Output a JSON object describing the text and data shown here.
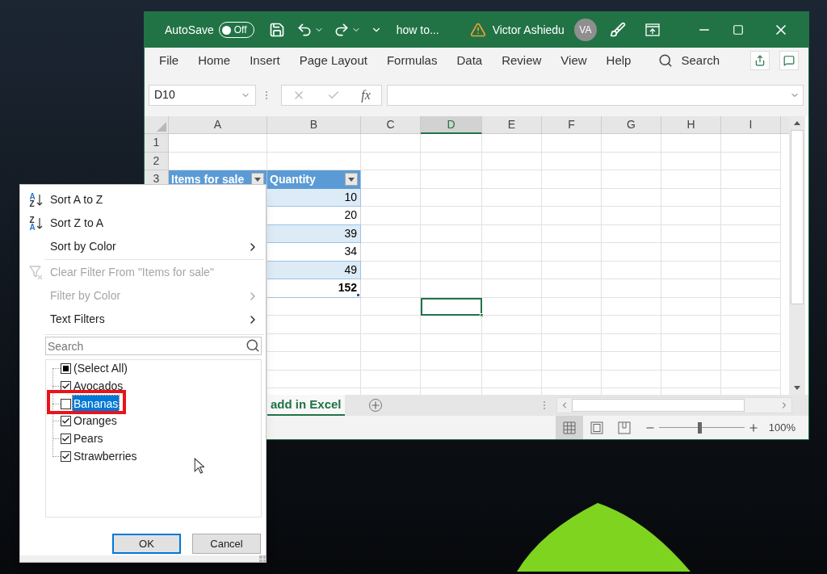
{
  "excel": {
    "title_bar": {
      "autosave_label": "AutoSave",
      "autosave_on": false,
      "autosave_state": "Off",
      "file_name": "how to...",
      "user_name": "Victor Ashiedu",
      "user_initials": "VA"
    },
    "ribbon_tabs": [
      "File",
      "Home",
      "Insert",
      "Page Layout",
      "Formulas",
      "Data",
      "Review",
      "View",
      "Help"
    ],
    "search_label": "Search",
    "name_box": "D10",
    "formula_fx": "fx",
    "columns": [
      {
        "label": "A",
        "selected": false
      },
      {
        "label": "B",
        "selected": false
      },
      {
        "label": "C",
        "selected": false
      },
      {
        "label": "D",
        "selected": true
      },
      {
        "label": "E",
        "selected": false
      },
      {
        "label": "F",
        "selected": false
      },
      {
        "label": "G",
        "selected": false
      },
      {
        "label": "H",
        "selected": false
      },
      {
        "label": "I",
        "selected": false
      }
    ],
    "row_numbers": [
      "1",
      "2",
      "3"
    ],
    "table_headers": [
      "Items for sale",
      "Quantity"
    ],
    "quantities": [
      {
        "value": "10",
        "banded": true,
        "kind": "data"
      },
      {
        "value": "20",
        "banded": false,
        "kind": "data"
      },
      {
        "value": "39",
        "banded": true,
        "kind": "data"
      },
      {
        "value": "34",
        "banded": false,
        "kind": "data"
      },
      {
        "value": "49",
        "banded": true,
        "kind": "data"
      },
      {
        "value": "152",
        "banded": false,
        "kind": "total"
      }
    ],
    "sheet_tab": "add in Excel",
    "view_buttons": [
      {
        "kind": "normal",
        "selected": true
      },
      {
        "kind": "page_layout",
        "selected": false
      },
      {
        "kind": "page_break",
        "selected": false
      }
    ],
    "zoom": {
      "level": 0.47,
      "reading": "100%"
    }
  },
  "filter_menu": {
    "items": [
      {
        "kind": "sort",
        "label": "Sort A to Z",
        "disabled": false,
        "icon_letters": [
          {
            "text": "A",
            "color": "#2b79d0"
          },
          {
            "text": "Z",
            "color": "#333333"
          }
        ]
      },
      {
        "kind": "sort",
        "label": "Sort Z to A",
        "disabled": false,
        "icon_letters": [
          {
            "text": "Z",
            "color": "#333333"
          },
          {
            "text": "A",
            "color": "#2b79d0"
          }
        ]
      },
      {
        "kind": "submenu",
        "label": "Sort by Color",
        "disabled": false
      },
      {
        "kind": "divider"
      },
      {
        "kind": "clear",
        "label": "Clear Filter From \"Items for sale\"",
        "disabled": true
      },
      {
        "kind": "submenu",
        "label": "Filter by Color",
        "disabled": true
      },
      {
        "kind": "submenu",
        "label": "Text Filters",
        "disabled": false
      }
    ],
    "search_placeholder": "Search",
    "values": [
      {
        "label": "(Select All)",
        "checked": false,
        "partial": true,
        "selected": false
      },
      {
        "label": "Avocados",
        "checked": true,
        "partial": false,
        "selected": false
      },
      {
        "label": "Bananas",
        "checked": false,
        "partial": false,
        "selected": true
      },
      {
        "label": "Oranges",
        "checked": true,
        "partial": false,
        "selected": false
      },
      {
        "label": "Pears",
        "checked": true,
        "partial": false,
        "selected": false
      },
      {
        "label": "Strawberries",
        "checked": true,
        "partial": false,
        "selected": false
      }
    ],
    "buttons": [
      "OK",
      "Cancel"
    ]
  }
}
